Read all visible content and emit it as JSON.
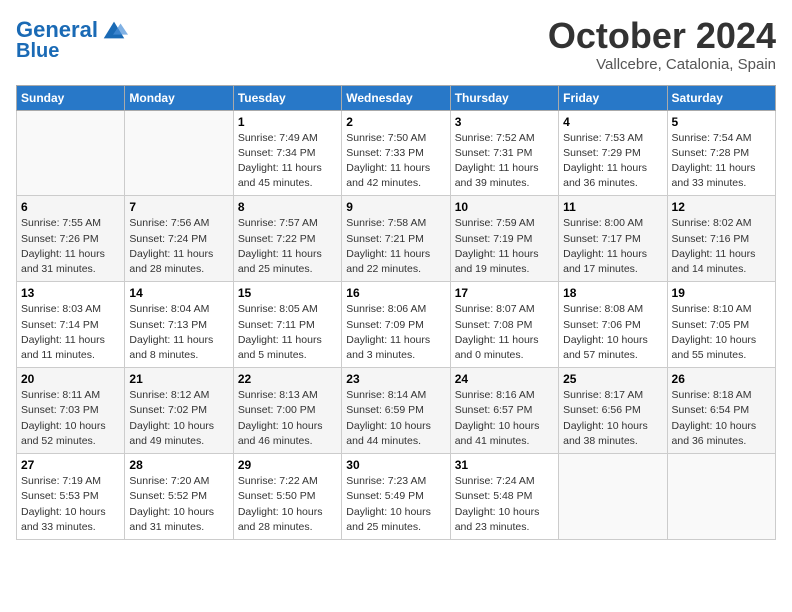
{
  "header": {
    "logo_line1": "General",
    "logo_line2": "Blue",
    "month_title": "October 2024",
    "location": "Vallcebre, Catalonia, Spain"
  },
  "weekdays": [
    "Sunday",
    "Monday",
    "Tuesday",
    "Wednesday",
    "Thursday",
    "Friday",
    "Saturday"
  ],
  "weeks": [
    [
      {
        "num": "",
        "detail": ""
      },
      {
        "num": "",
        "detail": ""
      },
      {
        "num": "1",
        "detail": "Sunrise: 7:49 AM\nSunset: 7:34 PM\nDaylight: 11 hours and 45 minutes."
      },
      {
        "num": "2",
        "detail": "Sunrise: 7:50 AM\nSunset: 7:33 PM\nDaylight: 11 hours and 42 minutes."
      },
      {
        "num": "3",
        "detail": "Sunrise: 7:52 AM\nSunset: 7:31 PM\nDaylight: 11 hours and 39 minutes."
      },
      {
        "num": "4",
        "detail": "Sunrise: 7:53 AM\nSunset: 7:29 PM\nDaylight: 11 hours and 36 minutes."
      },
      {
        "num": "5",
        "detail": "Sunrise: 7:54 AM\nSunset: 7:28 PM\nDaylight: 11 hours and 33 minutes."
      }
    ],
    [
      {
        "num": "6",
        "detail": "Sunrise: 7:55 AM\nSunset: 7:26 PM\nDaylight: 11 hours and 31 minutes."
      },
      {
        "num": "7",
        "detail": "Sunrise: 7:56 AM\nSunset: 7:24 PM\nDaylight: 11 hours and 28 minutes."
      },
      {
        "num": "8",
        "detail": "Sunrise: 7:57 AM\nSunset: 7:22 PM\nDaylight: 11 hours and 25 minutes."
      },
      {
        "num": "9",
        "detail": "Sunrise: 7:58 AM\nSunset: 7:21 PM\nDaylight: 11 hours and 22 minutes."
      },
      {
        "num": "10",
        "detail": "Sunrise: 7:59 AM\nSunset: 7:19 PM\nDaylight: 11 hours and 19 minutes."
      },
      {
        "num": "11",
        "detail": "Sunrise: 8:00 AM\nSunset: 7:17 PM\nDaylight: 11 hours and 17 minutes."
      },
      {
        "num": "12",
        "detail": "Sunrise: 8:02 AM\nSunset: 7:16 PM\nDaylight: 11 hours and 14 minutes."
      }
    ],
    [
      {
        "num": "13",
        "detail": "Sunrise: 8:03 AM\nSunset: 7:14 PM\nDaylight: 11 hours and 11 minutes."
      },
      {
        "num": "14",
        "detail": "Sunrise: 8:04 AM\nSunset: 7:13 PM\nDaylight: 11 hours and 8 minutes."
      },
      {
        "num": "15",
        "detail": "Sunrise: 8:05 AM\nSunset: 7:11 PM\nDaylight: 11 hours and 5 minutes."
      },
      {
        "num": "16",
        "detail": "Sunrise: 8:06 AM\nSunset: 7:09 PM\nDaylight: 11 hours and 3 minutes."
      },
      {
        "num": "17",
        "detail": "Sunrise: 8:07 AM\nSunset: 7:08 PM\nDaylight: 11 hours and 0 minutes."
      },
      {
        "num": "18",
        "detail": "Sunrise: 8:08 AM\nSunset: 7:06 PM\nDaylight: 10 hours and 57 minutes."
      },
      {
        "num": "19",
        "detail": "Sunrise: 8:10 AM\nSunset: 7:05 PM\nDaylight: 10 hours and 55 minutes."
      }
    ],
    [
      {
        "num": "20",
        "detail": "Sunrise: 8:11 AM\nSunset: 7:03 PM\nDaylight: 10 hours and 52 minutes."
      },
      {
        "num": "21",
        "detail": "Sunrise: 8:12 AM\nSunset: 7:02 PM\nDaylight: 10 hours and 49 minutes."
      },
      {
        "num": "22",
        "detail": "Sunrise: 8:13 AM\nSunset: 7:00 PM\nDaylight: 10 hours and 46 minutes."
      },
      {
        "num": "23",
        "detail": "Sunrise: 8:14 AM\nSunset: 6:59 PM\nDaylight: 10 hours and 44 minutes."
      },
      {
        "num": "24",
        "detail": "Sunrise: 8:16 AM\nSunset: 6:57 PM\nDaylight: 10 hours and 41 minutes."
      },
      {
        "num": "25",
        "detail": "Sunrise: 8:17 AM\nSunset: 6:56 PM\nDaylight: 10 hours and 38 minutes."
      },
      {
        "num": "26",
        "detail": "Sunrise: 8:18 AM\nSunset: 6:54 PM\nDaylight: 10 hours and 36 minutes."
      }
    ],
    [
      {
        "num": "27",
        "detail": "Sunrise: 7:19 AM\nSunset: 5:53 PM\nDaylight: 10 hours and 33 minutes."
      },
      {
        "num": "28",
        "detail": "Sunrise: 7:20 AM\nSunset: 5:52 PM\nDaylight: 10 hours and 31 minutes."
      },
      {
        "num": "29",
        "detail": "Sunrise: 7:22 AM\nSunset: 5:50 PM\nDaylight: 10 hours and 28 minutes."
      },
      {
        "num": "30",
        "detail": "Sunrise: 7:23 AM\nSunset: 5:49 PM\nDaylight: 10 hours and 25 minutes."
      },
      {
        "num": "31",
        "detail": "Sunrise: 7:24 AM\nSunset: 5:48 PM\nDaylight: 10 hours and 23 minutes."
      },
      {
        "num": "",
        "detail": ""
      },
      {
        "num": "",
        "detail": ""
      }
    ]
  ]
}
